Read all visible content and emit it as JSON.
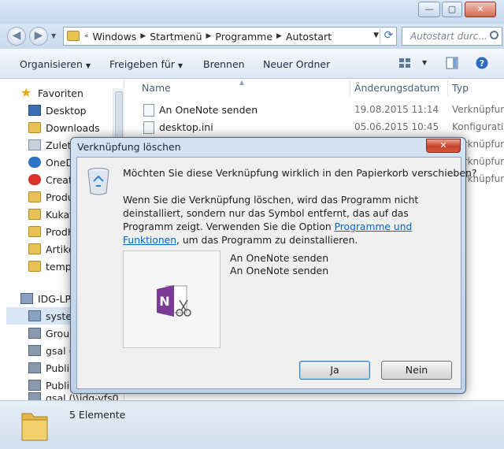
{
  "window": {
    "controls": {
      "minimize": "—",
      "maximize": "▢",
      "close": "✕"
    }
  },
  "address": {
    "prefix": "«",
    "crumbs": [
      "Windows",
      "Startmenü",
      "Programme",
      "Autostart"
    ],
    "search_placeholder": "Autostart durc..."
  },
  "toolbar": {
    "organize": "Organisieren",
    "share": "Freigeben für",
    "burn": "Brennen",
    "new_folder": "Neuer Ordner"
  },
  "sidebar": {
    "items": [
      {
        "label": "Favoriten",
        "icon": "star-icon"
      },
      {
        "label": "Desktop",
        "icon": "desktop-icon"
      },
      {
        "label": "Downloads",
        "icon": "folder-icon"
      },
      {
        "label": "Zulet",
        "icon": "recent-places-icon"
      },
      {
        "label": "OneD",
        "icon": "onedrive-icon"
      },
      {
        "label": "Creat",
        "icon": "creative-cloud-icon"
      },
      {
        "label": "Produ",
        "icon": "folder-icon"
      },
      {
        "label": "Kukat",
        "icon": "folder-icon"
      },
      {
        "label": "ProdH",
        "icon": "folder-icon"
      },
      {
        "label": "Artike",
        "icon": "folder-icon"
      },
      {
        "label": "temp",
        "icon": "folder-icon"
      },
      {
        "label": "IDG-LP",
        "icon": "computer-icon"
      },
      {
        "label": "syster",
        "icon": "drive-icon"
      },
      {
        "label": "Group",
        "icon": "network-drive-icon"
      },
      {
        "label": "gsal (",
        "icon": "network-drive-icon"
      },
      {
        "label": "Publi",
        "icon": "network-drive-icon"
      },
      {
        "label": "Publi",
        "icon": "network-drive-icon"
      },
      {
        "label": "gsal (\\\\idg-vfs0",
        "icon": "network-drive-icon"
      }
    ]
  },
  "filelist": {
    "columns": {
      "name": "Name",
      "date": "Änderungsdatum",
      "type": "Typ"
    },
    "rows": [
      {
        "name": "An OneNote senden",
        "date": "19.08.2015 11:14",
        "type": "Verknüpfung"
      },
      {
        "name": "desktop.ini",
        "date": "05.06.2015 10:45",
        "type": "Konfiguration"
      }
    ],
    "hidden_types": [
      "Verknüpfung",
      "Verknüpfung",
      "Verknüpfung"
    ]
  },
  "status": {
    "count": "5 Elemente"
  },
  "dialog": {
    "title": "Verknüpfung löschen",
    "close": "✕",
    "question": "Möchten Sie diese Verknüpfung wirklich in den Papierkorb verschieben?",
    "desc_part1": "Wenn Sie die Verknüpfung löschen, wird das Programm nicht deinstalliert, sondern nur das Symbol entfernt, das auf das Programm zeigt. Verwenden Sie die Option ",
    "link": "Programme und Funktionen",
    "desc_part2": ", um das Programm zu deinstallieren.",
    "preview_line1": "An OneNote senden",
    "preview_line2": "An OneNote senden",
    "yes": "Ja",
    "no": "Nein"
  },
  "colors": {
    "accent_link": "#0066cc",
    "onenote_purple": "#7b3a96",
    "close_red": "#c4412b"
  }
}
